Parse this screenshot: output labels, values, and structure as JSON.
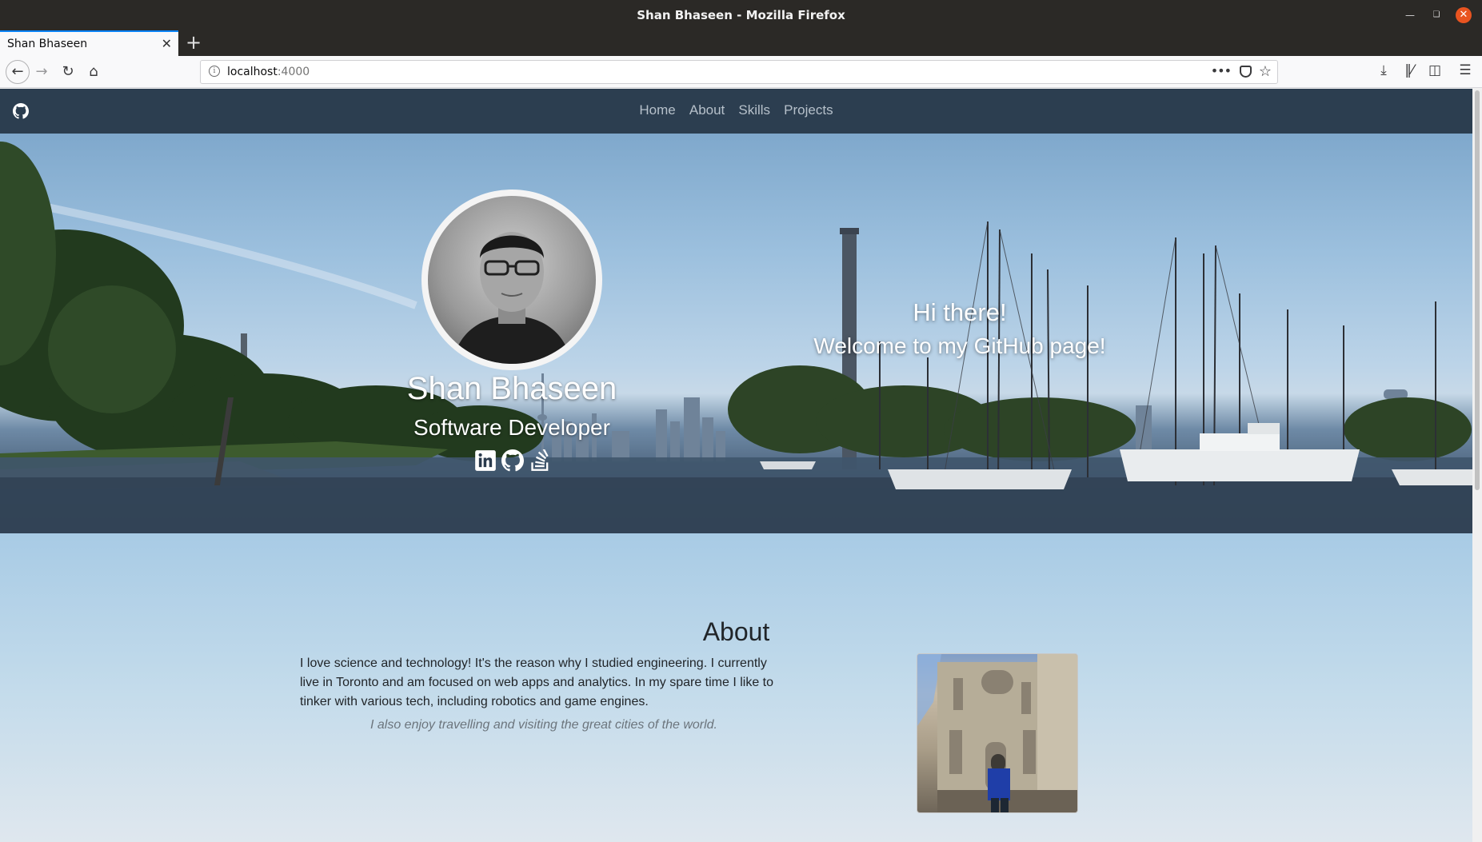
{
  "browser": {
    "window_title": "Shan Bhaseen - Mozilla Firefox",
    "tab_title": "Shan Bhaseen",
    "url_host": "localhost",
    "url_port": ":4000"
  },
  "site": {
    "nav": {
      "links": [
        "Home",
        "About",
        "Skills",
        "Projects"
      ]
    },
    "hero": {
      "name": "Shan Bhaseen",
      "role": "Software Developer",
      "greeting": "Hi there!",
      "welcome": "Welcome to my GitHub page!",
      "social_icons": [
        "linkedin-icon",
        "github-icon",
        "stackoverflow-icon"
      ]
    },
    "about": {
      "title": "About",
      "text": "I love science and technology! It's the reason why I studied engineering. I currently live in Toronto and am focused on web apps and analytics. In my spare time I like to tinker with various tech, including robotics and game engines.",
      "quote": "I also enjoy travelling and visiting the great cities of the world."
    }
  },
  "colors": {
    "navbar": "#2c3e50",
    "nav_link": "#b6c0ca",
    "tab_accent": "#0a84ff",
    "close_button": "#e95420"
  }
}
